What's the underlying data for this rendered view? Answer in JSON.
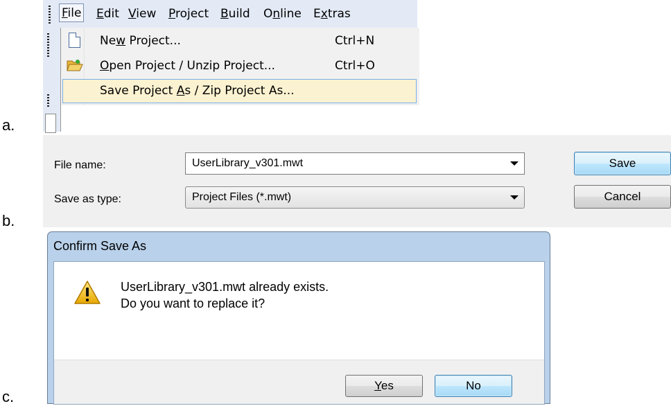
{
  "labels": {
    "a": "a.",
    "b": "b.",
    "c": "c."
  },
  "menubar": {
    "items": [
      "File",
      "Edit",
      "View",
      "Project",
      "Build",
      "Online",
      "Extras"
    ]
  },
  "file_menu": {
    "items": [
      {
        "label": "New Project...",
        "shortcut": "Ctrl+N",
        "icon": "new-document-icon"
      },
      {
        "label": "Open Project / Unzip Project...",
        "shortcut": "Ctrl+O",
        "icon": "open-folder-icon"
      },
      {
        "label": "Save Project As / Zip Project As...",
        "shortcut": "",
        "icon": ""
      }
    ],
    "highlighted_index": 2
  },
  "save_dialog": {
    "file_name_label": "File name:",
    "file_name_value": "UserLibrary_v301.mwt",
    "save_type_label": "Save as type:",
    "save_type_value": "Project Files (*.mwt)",
    "save_button": "Save",
    "cancel_button": "Cancel"
  },
  "confirm_dialog": {
    "title": "Confirm Save As",
    "message_line1": "UserLibrary_v301.mwt already exists.",
    "message_line2": "Do you want to replace it?",
    "yes_button": "Yes",
    "no_button": "No",
    "icon": "warning-icon"
  },
  "colors": {
    "menu_highlight": "#fbf2d1",
    "menu_highlight_border": "#78aee6",
    "dialog_title_bar": "#b9d1ea",
    "default_button": "#bee6fd"
  }
}
